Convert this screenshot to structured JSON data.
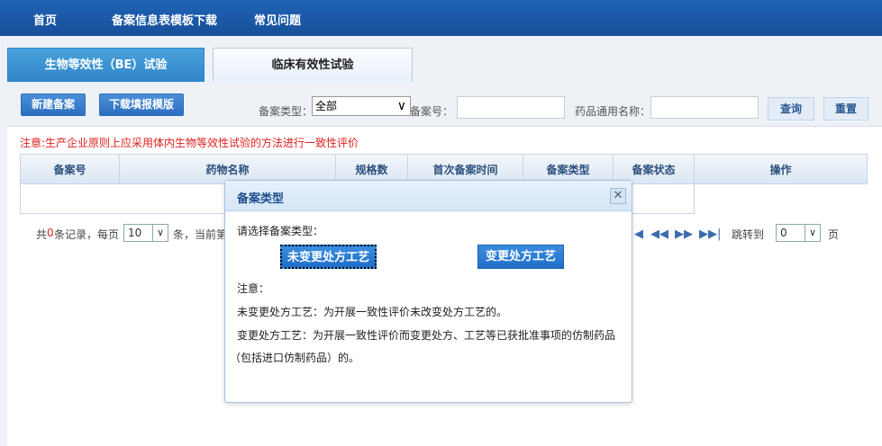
{
  "nav": {
    "items": [
      {
        "label": "首页"
      },
      {
        "label": "备案信息表模板下载"
      },
      {
        "label": "常见问题"
      }
    ]
  },
  "tabs": [
    {
      "label": "生物等效性（BE）试验",
      "active": true
    },
    {
      "label": "临床有效性试验",
      "active": false
    }
  ],
  "toolbar": {
    "new_label": "新建备案",
    "download_label": "下载填报模版",
    "type_label": "备案类型：",
    "type_value": "全部",
    "number_label": "备案号：",
    "number_value": "",
    "drug_label": "药品通用名称：",
    "drug_value": "",
    "query_label": "查询",
    "reset_label": "重置"
  },
  "notice": "注意:生产企业原则上应采用体内生物等效性试验的方法进行一致性评价",
  "table": {
    "columns": [
      "备案号",
      "药物名称",
      "规格数",
      "首次备案时间",
      "备案类型",
      "备案状态",
      "操作"
    ]
  },
  "pager": {
    "text_prefix": "共",
    "count": "0",
    "text_mid": "条记录，每页",
    "per_page": "10",
    "text_mid2": "条，当前第",
    "jump_label": "跳转到",
    "jump_value": "0",
    "page_suffix": "页"
  },
  "modal": {
    "title": "备案类型",
    "prompt": "请选择备案类型：",
    "btn_unchanged": "未变更处方工艺",
    "btn_changed": "变更处方工艺",
    "note_title": "注意：",
    "note_1": "未变更处方工艺：为开展一致性评价未改变处方工艺的。",
    "note_2": "变更处方工艺：为开展一致性评价而变更处方、工艺等已获批准事项的仿制药品",
    "note_3": "（包括进口仿制药品）的。"
  },
  "colors": {
    "nav_bg": "#1f63b6",
    "accent": "#2f84c9",
    "notice": "#e02020"
  }
}
